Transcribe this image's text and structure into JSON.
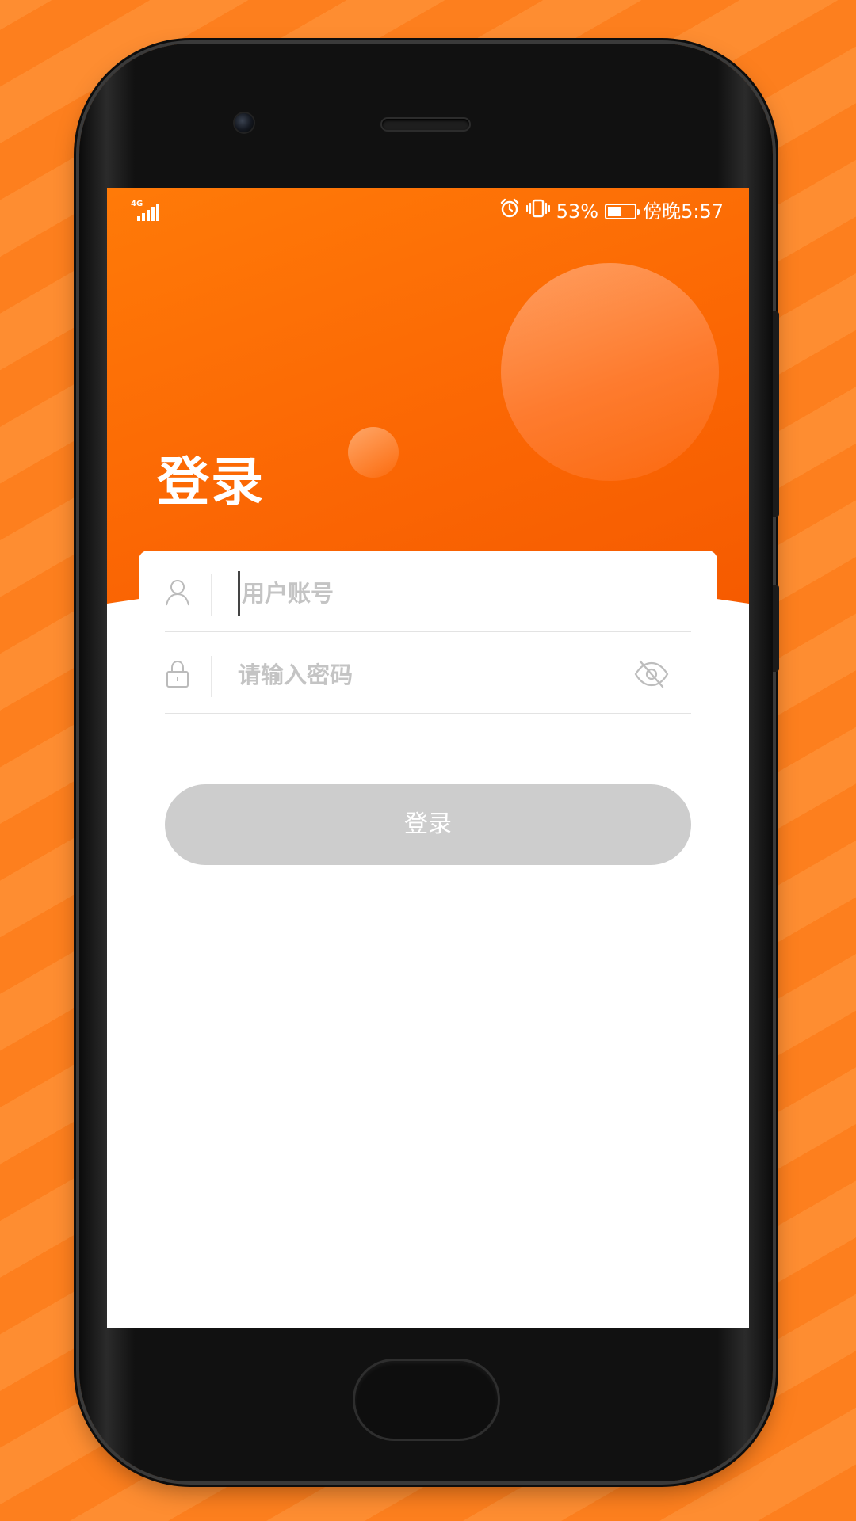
{
  "status_bar": {
    "network": "4G",
    "battery_percent": "53%",
    "battery_level": 0.53,
    "time": "傍晚5:57"
  },
  "page": {
    "title": "登录"
  },
  "form": {
    "username_placeholder": "用户账号",
    "password_placeholder": "请输入密码",
    "login_label": "登录"
  },
  "icons": {
    "user": "user-icon",
    "lock": "lock-icon",
    "eye": "eye-off-icon",
    "alarm": "alarm-icon",
    "vibrate": "vibrate-icon"
  },
  "colors": {
    "brand_orange": "#fb6704",
    "button_disabled": "#cdcdcd",
    "background_stripe_a": "#fd7f1e",
    "background_stripe_b": "#fe8d31"
  }
}
